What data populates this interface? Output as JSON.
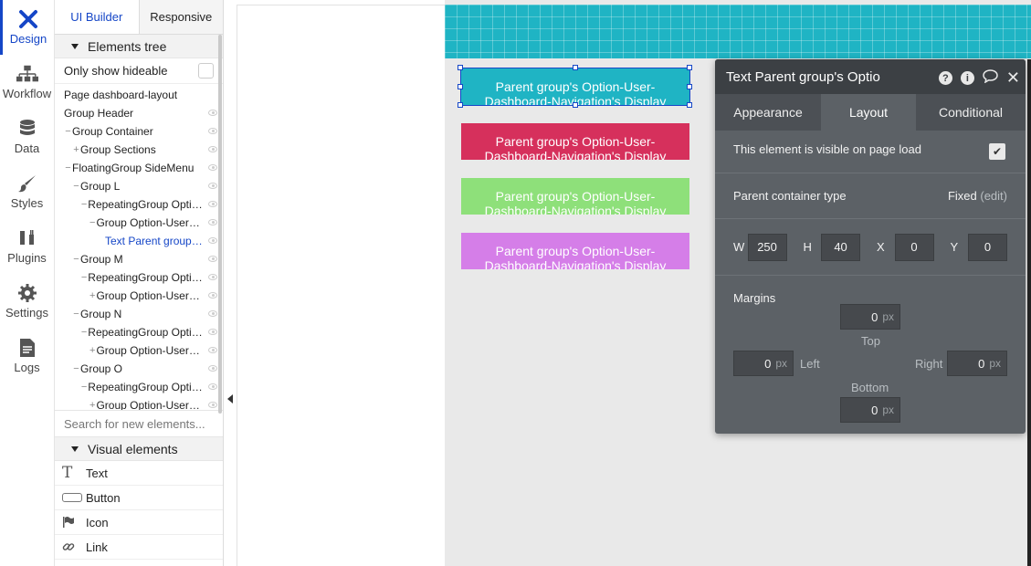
{
  "rail": [
    {
      "label": "Design",
      "icon": "design-icon",
      "active": true
    },
    {
      "label": "Workflow",
      "icon": "workflow-icon"
    },
    {
      "label": "Data",
      "icon": "database-icon"
    },
    {
      "label": "Styles",
      "icon": "brush-icon"
    },
    {
      "label": "Plugins",
      "icon": "plug-icon"
    },
    {
      "label": "Settings",
      "icon": "gear-icon"
    },
    {
      "label": "Logs",
      "icon": "document-icon"
    }
  ],
  "left_panel": {
    "tabs": [
      "UI Builder",
      "Responsive"
    ],
    "elements_tree_title": "Elements tree",
    "only_show_hideable": "Only show hideable",
    "tree": [
      {
        "label": "Page dashboard-layout",
        "indent": 0,
        "marker": ""
      },
      {
        "label": "Group Header",
        "indent": 0,
        "marker": ""
      },
      {
        "label": "Group Container",
        "indent": 0,
        "marker": "−"
      },
      {
        "label": "Group Sections",
        "indent": 1,
        "marker": "+"
      },
      {
        "label": "FloatingGroup SideMenu",
        "indent": 0,
        "marker": "−"
      },
      {
        "label": "Group L",
        "indent": 1,
        "marker": "−"
      },
      {
        "label": "RepeatingGroup Option...",
        "indent": 2,
        "marker": "−"
      },
      {
        "label": "Group Option-User-D...",
        "indent": 3,
        "marker": "−"
      },
      {
        "label": "Text Parent group's ...",
        "indent": 4,
        "marker": "",
        "selected": true
      },
      {
        "label": "Group M",
        "indent": 1,
        "marker": "−"
      },
      {
        "label": "RepeatingGroup Option...",
        "indent": 2,
        "marker": "−"
      },
      {
        "label": "Group Option-User-D...",
        "indent": 3,
        "marker": "+"
      },
      {
        "label": "Group N",
        "indent": 1,
        "marker": "−"
      },
      {
        "label": "RepeatingGroup Option...",
        "indent": 2,
        "marker": "−"
      },
      {
        "label": "Group Option-User-D...",
        "indent": 3,
        "marker": "+"
      },
      {
        "label": "Group O",
        "indent": 1,
        "marker": "−"
      },
      {
        "label": "RepeatingGroup Option...",
        "indent": 2,
        "marker": "−"
      },
      {
        "label": "Group Option-User-D...",
        "indent": 3,
        "marker": "+"
      }
    ],
    "search_placeholder": "Search for new elements...",
    "visual_elements_title": "Visual elements",
    "visual_elements": [
      {
        "label": "Text",
        "icon": "text-icon"
      },
      {
        "label": "Button",
        "icon": "button-icon"
      },
      {
        "label": "Icon",
        "icon": "flag-icon"
      },
      {
        "label": "Link",
        "icon": "link-icon"
      }
    ]
  },
  "canvas": {
    "option_line1": "Parent group's Option-User-",
    "option_line2": "Dashboard-Navigation's Display",
    "option_colors": [
      "#1fb4c4",
      "#d6305c",
      "#8ee07a",
      "#d57ee8"
    ]
  },
  "property_editor": {
    "title": "Text Parent group's Optio",
    "tabs": [
      "Appearance",
      "Layout",
      "Conditional"
    ],
    "active_tab": "Layout",
    "visible_on_load": "This element is visible on page load",
    "visible_checked": true,
    "parent_container_label": "Parent container type",
    "parent_container_value": "Fixed",
    "edit_label": "(edit)",
    "dims": {
      "W": "250",
      "H": "40",
      "X": "0",
      "Y": "0"
    },
    "dim_labels": {
      "W": "W",
      "H": "H",
      "X": "X",
      "Y": "Y"
    },
    "margins_label": "Margins",
    "margins": {
      "top": "0",
      "left": "0",
      "right": "0",
      "bottom": "0"
    },
    "margin_labels": {
      "top": "Top",
      "left": "Left",
      "right": "Right",
      "bottom": "Bottom"
    },
    "unit": "px"
  }
}
